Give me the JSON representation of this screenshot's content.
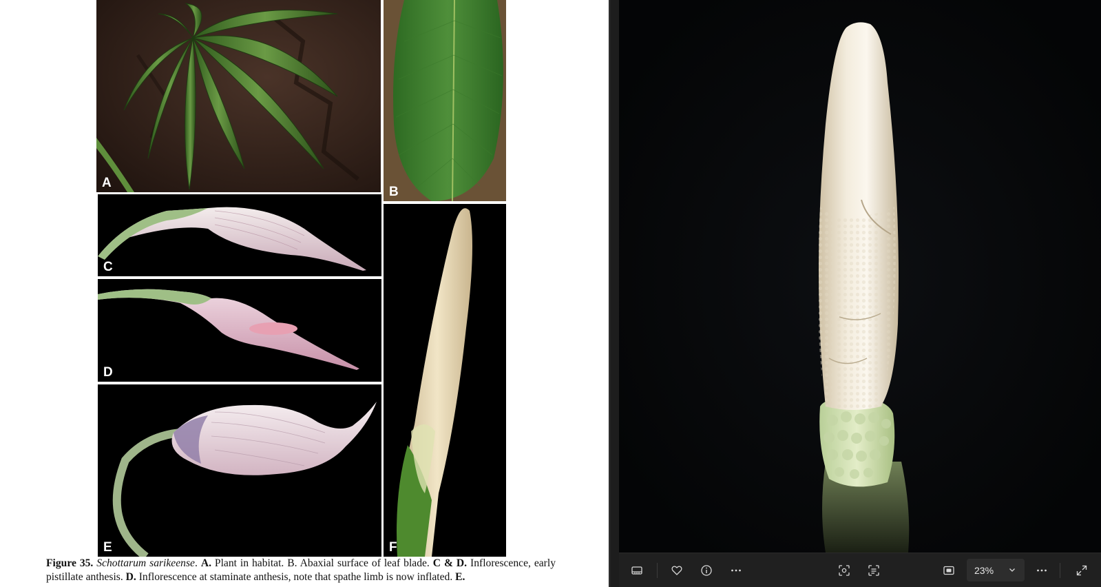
{
  "document": {
    "panels": [
      {
        "id": "A",
        "label": "A"
      },
      {
        "id": "B",
        "label": "B"
      },
      {
        "id": "C",
        "label": "C"
      },
      {
        "id": "D",
        "label": "D"
      },
      {
        "id": "E",
        "label": "E"
      },
      {
        "id": "F",
        "label": "F"
      }
    ],
    "caption": {
      "figure": "Figure 35.",
      "species": "Schottarum sarikeense",
      "species_end": ".",
      "a_label": "A.",
      "a_text": " Plant in habitat. B. Abaxial surface of leaf blade. ",
      "cd_label": "C & D.",
      "cd_text": " Inflorescence, early pistillate anthesis. ",
      "d_label": "D.",
      "d_text": " Inflorescence at staminate anthesis, note that spathe limb is now inflated. ",
      "e_label": "E."
    }
  },
  "viewer": {
    "zoom": "23%",
    "background": "#050608",
    "toolbar_icons": [
      "filmstrip-icon",
      "heart-icon",
      "info-icon",
      "more-icon",
      "visual-search-icon",
      "scan-text-icon",
      "fit-to-window-icon",
      "more-icon",
      "fullscreen-icon"
    ]
  }
}
